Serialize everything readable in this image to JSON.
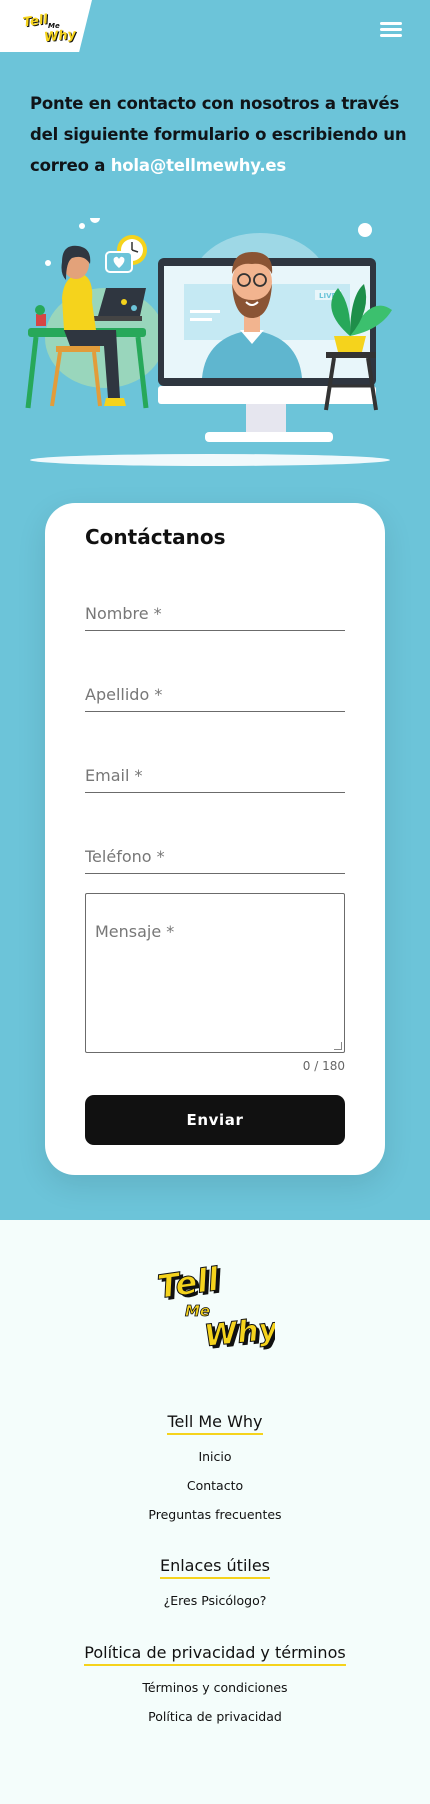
{
  "header": {
    "logo_alt": "Tell Me Why",
    "menu_icon": "hamburger-icon"
  },
  "intro": {
    "text": "Ponte en contacto con nosotros a través del siguiente formulario o escribiendo un correo a ",
    "email": "hola@tellmewhy.es"
  },
  "illustration": {
    "screen_badge": "LIVE",
    "icons": [
      "clock-icon",
      "heart-message-icon",
      "plant-icon"
    ]
  },
  "form": {
    "title": "Contáctanos",
    "fields": {
      "nombre": {
        "placeholder": "Nombre *",
        "value": ""
      },
      "apellido": {
        "placeholder": "Apellido *",
        "value": ""
      },
      "email": {
        "placeholder": "Email *",
        "value": ""
      },
      "telefono": {
        "placeholder": "Teléfono *",
        "value": ""
      },
      "mensaje": {
        "placeholder": "Mensaje *",
        "value": ""
      }
    },
    "counter": "0 / 180",
    "submit_label": "Enviar"
  },
  "footer": {
    "sections": [
      {
        "title": "Tell Me Why",
        "links": [
          "Inicio",
          "Contacto",
          "Preguntas frecuentes"
        ]
      },
      {
        "title": "Enlaces útiles",
        "links": [
          "¿Eres Psicólogo?"
        ]
      },
      {
        "title": "Política de privacidad y términos",
        "links": [
          "Términos y condiciones",
          "Política de privacidad"
        ]
      }
    ]
  },
  "colors": {
    "hero_bg": "#6cc4d9",
    "accent_yellow": "#f5d31c",
    "button_bg": "#111111",
    "footer_bg": "#f4fdfb"
  }
}
